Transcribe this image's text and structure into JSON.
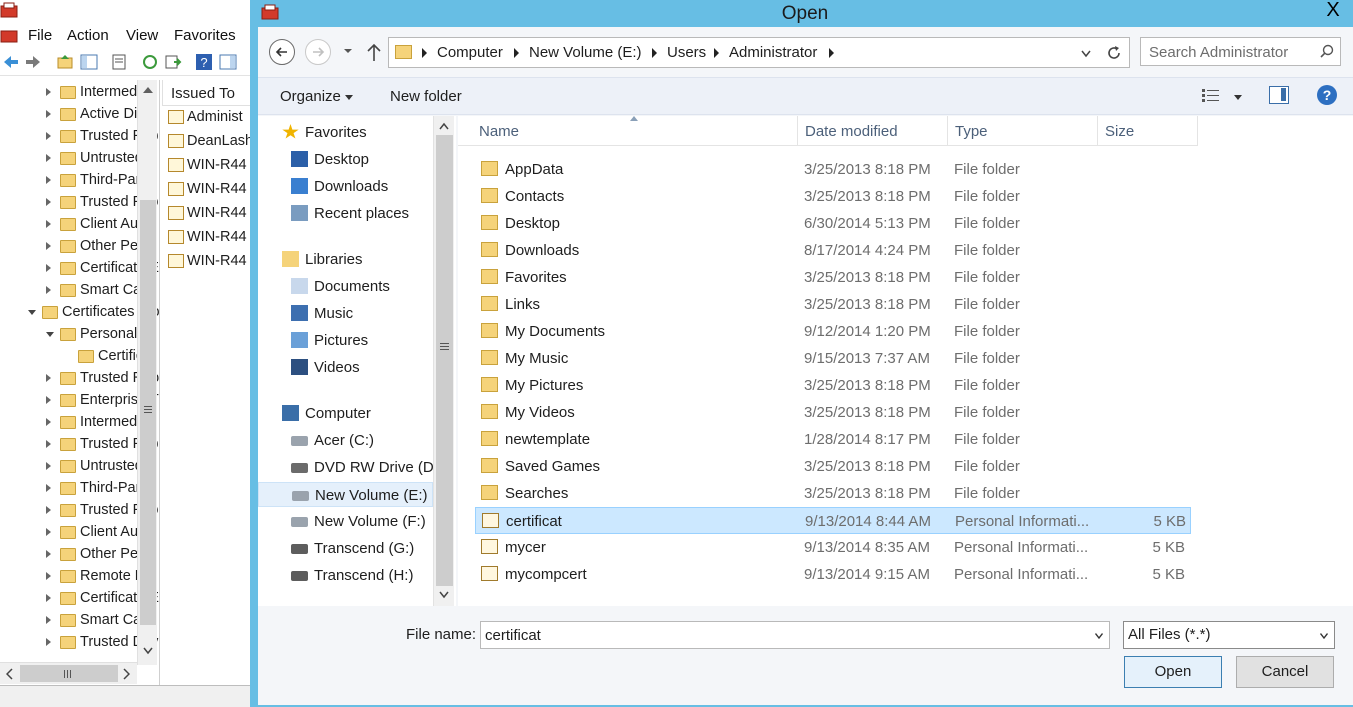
{
  "mmc": {
    "menu": [
      "File",
      "Action",
      "View",
      "Favorites"
    ],
    "tree": [
      {
        "label": "Intermediat",
        "indent": 1,
        "arrow": "closed"
      },
      {
        "label": "Active Direc",
        "indent": 1,
        "arrow": "closed"
      },
      {
        "label": "Trusted Pub",
        "indent": 1,
        "arrow": "closed"
      },
      {
        "label": "Untrusted C",
        "indent": 1,
        "arrow": "closed"
      },
      {
        "label": "Third-Party",
        "indent": 1,
        "arrow": "closed"
      },
      {
        "label": "Trusted Peo",
        "indent": 1,
        "arrow": "closed"
      },
      {
        "label": "Client Auth",
        "indent": 1,
        "arrow": "closed"
      },
      {
        "label": "Other Peop",
        "indent": 1,
        "arrow": "closed"
      },
      {
        "label": "Certificate E",
        "indent": 1,
        "arrow": "closed"
      },
      {
        "label": "Smart Card",
        "indent": 1,
        "arrow": "closed"
      },
      {
        "label": "Certificates (Lo",
        "indent": 0,
        "arrow": "open"
      },
      {
        "label": "Personal",
        "indent": 1,
        "arrow": "open"
      },
      {
        "label": "Certificat",
        "indent": 2,
        "arrow": "none"
      },
      {
        "label": "Trusted Roo",
        "indent": 1,
        "arrow": "closed"
      },
      {
        "label": "Enterprise T",
        "indent": 1,
        "arrow": "closed"
      },
      {
        "label": "Intermediat",
        "indent": 1,
        "arrow": "closed"
      },
      {
        "label": "Trusted Pub",
        "indent": 1,
        "arrow": "closed"
      },
      {
        "label": "Untrusted C",
        "indent": 1,
        "arrow": "closed"
      },
      {
        "label": "Third-Party",
        "indent": 1,
        "arrow": "closed"
      },
      {
        "label": "Trusted Peo",
        "indent": 1,
        "arrow": "closed"
      },
      {
        "label": "Client Auth",
        "indent": 1,
        "arrow": "closed"
      },
      {
        "label": "Other Peop",
        "indent": 1,
        "arrow": "closed"
      },
      {
        "label": "Remote De",
        "indent": 1,
        "arrow": "closed"
      },
      {
        "label": "Certificate E",
        "indent": 1,
        "arrow": "closed"
      },
      {
        "label": "Smart Card",
        "indent": 1,
        "arrow": "closed"
      },
      {
        "label": "Trusted Dev",
        "indent": 1,
        "arrow": "closed"
      }
    ],
    "list_header": "Issued To",
    "list": [
      "Administ",
      "DeanLash",
      "WIN-R44",
      "WIN-R44",
      "WIN-R44",
      "WIN-R44",
      "WIN-R44"
    ]
  },
  "dialog": {
    "title": "Open",
    "close_glyph": "X",
    "breadcrumbs": [
      "Computer",
      "New Volume (E:)",
      "Users",
      "Administrator"
    ],
    "search_placeholder": "Search Administrator",
    "organize_label": "Organize",
    "new_folder_label": "New folder",
    "help_glyph": "?",
    "nav": [
      {
        "label": "Favorites",
        "icon": "star-icon",
        "level": 0,
        "group_gap": false
      },
      {
        "label": "Desktop",
        "icon": "desktop-icon",
        "level": 1,
        "group_gap": false
      },
      {
        "label": "Downloads",
        "icon": "downloads-icon",
        "level": 1,
        "group_gap": false
      },
      {
        "label": "Recent places",
        "icon": "recent-places-icon",
        "level": 1,
        "group_gap": false
      },
      {
        "label": "Libraries",
        "icon": "libraries-icon",
        "level": 0,
        "group_gap": true
      },
      {
        "label": "Documents",
        "icon": "documents-icon",
        "level": 1,
        "group_gap": false
      },
      {
        "label": "Music",
        "icon": "music-icon",
        "level": 1,
        "group_gap": false
      },
      {
        "label": "Pictures",
        "icon": "pictures-icon",
        "level": 1,
        "group_gap": false
      },
      {
        "label": "Videos",
        "icon": "videos-icon",
        "level": 1,
        "group_gap": false
      },
      {
        "label": "Computer",
        "icon": "computer-icon",
        "level": 0,
        "group_gap": true
      },
      {
        "label": "Acer (C:)",
        "icon": "drive-icon",
        "level": 1,
        "group_gap": false
      },
      {
        "label": "DVD RW Drive (D",
        "icon": "dvd-drive-icon",
        "level": 1,
        "group_gap": false
      },
      {
        "label": "New Volume (E:)",
        "icon": "drive-icon",
        "level": 1,
        "group_gap": false,
        "selected": true
      },
      {
        "label": "New Volume (F:)",
        "icon": "drive-icon",
        "level": 1,
        "group_gap": false
      },
      {
        "label": "Transcend (G:)",
        "icon": "removable-drive-icon",
        "level": 1,
        "group_gap": false
      },
      {
        "label": "Transcend (H:)",
        "icon": "removable-drive-icon",
        "level": 1,
        "group_gap": false
      }
    ],
    "columns": {
      "name": "Name",
      "date": "Date modified",
      "type": "Type",
      "size": "Size"
    },
    "files": [
      {
        "name": "AppData",
        "date": "3/25/2013 8:18 PM",
        "type": "File folder",
        "size": "",
        "kind": "folder"
      },
      {
        "name": "Contacts",
        "date": "3/25/2013 8:18 PM",
        "type": "File folder",
        "size": "",
        "kind": "folder"
      },
      {
        "name": "Desktop",
        "date": "6/30/2014 5:13 PM",
        "type": "File folder",
        "size": "",
        "kind": "folder"
      },
      {
        "name": "Downloads",
        "date": "8/17/2014 4:24 PM",
        "type": "File folder",
        "size": "",
        "kind": "folder"
      },
      {
        "name": "Favorites",
        "date": "3/25/2013 8:18 PM",
        "type": "File folder",
        "size": "",
        "kind": "folder"
      },
      {
        "name": "Links",
        "date": "3/25/2013 8:18 PM",
        "type": "File folder",
        "size": "",
        "kind": "folder"
      },
      {
        "name": "My Documents",
        "date": "9/12/2014 1:20 PM",
        "type": "File folder",
        "size": "",
        "kind": "folder"
      },
      {
        "name": "My Music",
        "date": "9/15/2013 7:37 AM",
        "type": "File folder",
        "size": "",
        "kind": "folder"
      },
      {
        "name": "My Pictures",
        "date": "3/25/2013 8:18 PM",
        "type": "File folder",
        "size": "",
        "kind": "folder"
      },
      {
        "name": "My Videos",
        "date": "3/25/2013 8:18 PM",
        "type": "File folder",
        "size": "",
        "kind": "folder"
      },
      {
        "name": "newtemplate",
        "date": "1/28/2014 8:17 PM",
        "type": "File folder",
        "size": "",
        "kind": "folder"
      },
      {
        "name": "Saved Games",
        "date": "3/25/2013 8:18 PM",
        "type": "File folder",
        "size": "",
        "kind": "folder"
      },
      {
        "name": "Searches",
        "date": "3/25/2013 8:18 PM",
        "type": "File folder",
        "size": "",
        "kind": "folder"
      },
      {
        "name": "certificat",
        "date": "9/13/2014 8:44 AM",
        "type": "Personal Informati...",
        "size": "5 KB",
        "kind": "cert",
        "selected": true
      },
      {
        "name": "mycer",
        "date": "9/13/2014 8:35 AM",
        "type": "Personal Informati...",
        "size": "5 KB",
        "kind": "cert"
      },
      {
        "name": "mycompcert",
        "date": "9/13/2014 9:15 AM",
        "type": "Personal Informati...",
        "size": "5 KB",
        "kind": "cert"
      }
    ],
    "file_name_label": "File name:",
    "file_name_value": "certificat",
    "file_type_value": "All Files (*.*)",
    "open_label": "Open",
    "cancel_label": "Cancel"
  },
  "colors": {
    "title_bar": "#67bee4",
    "selection": "#cce8ff",
    "link_text": "#1e3287"
  }
}
